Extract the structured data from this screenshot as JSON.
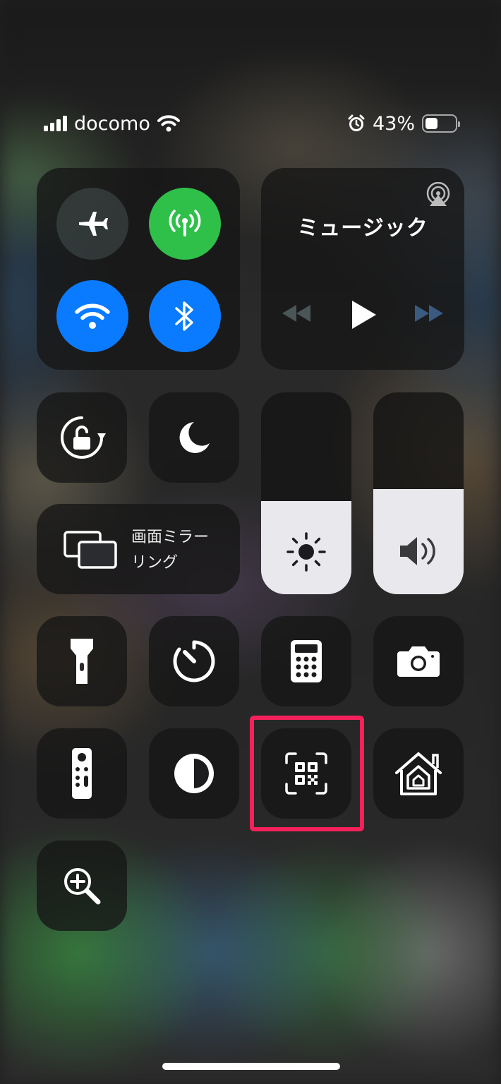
{
  "status_bar": {
    "carrier": "docomo",
    "battery_percent": "43%",
    "battery_level": 0.43,
    "icons": [
      "signal-bars-icon",
      "wifi-icon",
      "alarm-icon",
      "battery-icon"
    ]
  },
  "connectivity": {
    "airplane": {
      "icon": "airplane-icon",
      "state": "off"
    },
    "cellular": {
      "icon": "cellular-antenna-icon",
      "state": "on",
      "color": "#2fc04a"
    },
    "wifi": {
      "icon": "wifi-icon",
      "state": "on",
      "color": "#0a7bff"
    },
    "bluetooth": {
      "icon": "bluetooth-icon",
      "state": "on",
      "color": "#0a7bff"
    }
  },
  "music": {
    "title": "ミュージック",
    "icons": [
      "airplay-icon",
      "rewind-icon",
      "play-icon",
      "fast-forward-icon"
    ]
  },
  "screen_mirroring": {
    "label_line1": "画面ミラー",
    "label_line2": "リング",
    "icon": "screen-mirroring-icon"
  },
  "sliders": {
    "brightness_level": 0.46,
    "volume_level": 0.52,
    "icons": [
      "sun-icon",
      "speaker-icon"
    ]
  },
  "tiles": [
    {
      "id": "orientation-lock",
      "icon": "rotation-lock-icon"
    },
    {
      "id": "do-not-disturb",
      "icon": "moon-icon"
    },
    {
      "id": "flashlight",
      "icon": "flashlight-icon"
    },
    {
      "id": "timer",
      "icon": "timer-icon"
    },
    {
      "id": "calculator",
      "icon": "calculator-icon"
    },
    {
      "id": "camera",
      "icon": "camera-icon"
    },
    {
      "id": "apple-tv-remote",
      "icon": "remote-icon"
    },
    {
      "id": "dark-mode",
      "icon": "dark-mode-icon"
    },
    {
      "id": "code-scanner",
      "icon": "qr-code-scanner-icon",
      "highlighted": true
    },
    {
      "id": "home",
      "icon": "home-icon"
    },
    {
      "id": "magnifier",
      "icon": "magnifier-icon"
    }
  ],
  "colors": {
    "highlight": "#f5215b",
    "accent_blue": "#0a7bff",
    "accent_green": "#2fc04a"
  }
}
